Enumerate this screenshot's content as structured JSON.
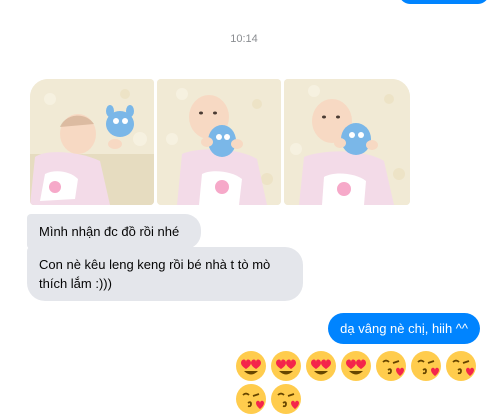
{
  "conversation": {
    "timestamp": "10:14",
    "photos": [
      "baby-photo-1",
      "baby-photo-2",
      "baby-photo-3"
    ],
    "received_messages": [
      "Mình nhận đc đồ rồi nhé",
      "Con nè kêu leng keng rồi bé nhà t tò mò thích lắm :)))"
    ],
    "sent_message": "dạ vâng nè chị, hiih ^^",
    "emoji_rows": [
      [
        "heart-eyes",
        "heart-eyes",
        "heart-eyes",
        "heart-eyes",
        "kissing-heart",
        "kissing-heart",
        "kissing-heart"
      ],
      [
        "kissing-heart",
        "kissing-heart"
      ]
    ]
  },
  "colors": {
    "sent_bubble": "#0084ff",
    "received_bubble": "#e4e6eb",
    "emoji_face": "#ffcc4d",
    "heart": "#f4254b"
  }
}
